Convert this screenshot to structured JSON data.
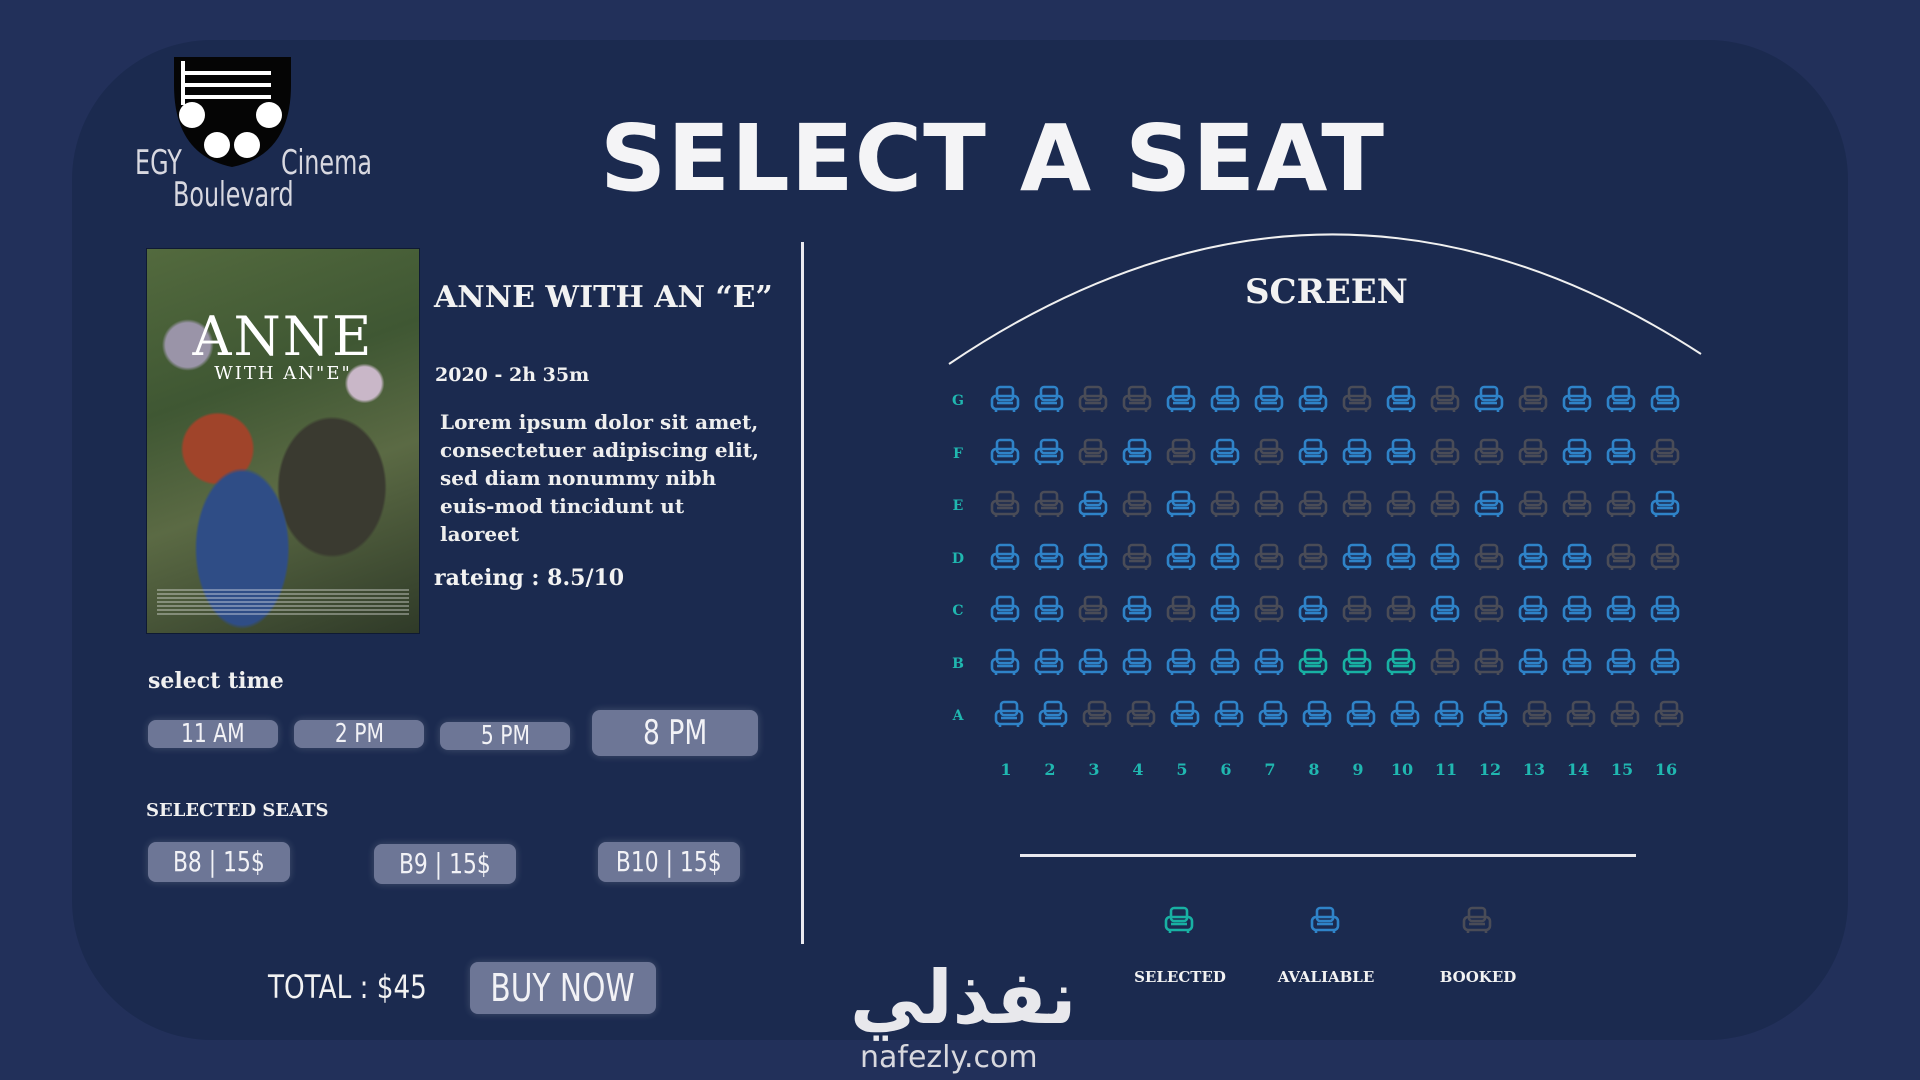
{
  "brand": {
    "line1_left": "EGY",
    "line1_right": "Cinema",
    "line2": "Boulevard"
  },
  "page_title": "SELECT A SEAT",
  "movie": {
    "poster_title": "ANNE",
    "poster_subtitle": "WITH AN\"E\"",
    "title": "ANNE WITH AN “E”",
    "meta": "2020 - 2h 35m",
    "description": "Lorem ipsum dolor sit amet, consectetuer adipiscing elit, sed diam nonummy nibh euis-mod tincidunt ut laoreet",
    "rating": "rateing : 8.5/10"
  },
  "time_select": {
    "label": "select time",
    "options": [
      "11 AM",
      "2 PM",
      "5 PM",
      "8 PM"
    ],
    "selected": "8 PM"
  },
  "selected_seats": {
    "label": "SELECTED SEATS",
    "items": [
      "B8 | 15$",
      "B9 | 15$",
      "B10 | 15$"
    ]
  },
  "total": "TOTAL : $45",
  "buy_button": "BUY NOW",
  "screen_label": "SCREEN",
  "seat_map": {
    "rows": [
      "G",
      "F",
      "E",
      "D",
      "C",
      "B",
      "A"
    ],
    "columns": [
      "1",
      "2",
      "3",
      "4",
      "5",
      "6",
      "7",
      "8",
      "9",
      "10",
      "11",
      "12",
      "13",
      "14",
      "15",
      "16"
    ],
    "status_codes": {
      "a": "available",
      "s": "selected",
      "b": "booked"
    },
    "layout": {
      "G": "aabbaaaabababaaa",
      "F": "aabababaaabbbaab",
      "E": "bbababbbbbbabbba",
      "D": "aaabaabbaaabaabb",
      "C": "aababababbabaaaa",
      "B": "aaaaaaasssbbaaaa",
      "A": "aabbaaaaaaaabbbb"
    }
  },
  "legend": [
    {
      "status": "selected",
      "label": "SELECTED"
    },
    {
      "status": "available",
      "label": "AVALIABLE"
    },
    {
      "status": "booked",
      "label": "BOOKED"
    }
  ],
  "colors": {
    "available": "#2f83c8",
    "selected": "#18b1a3",
    "booked": "#4a4c57",
    "panel": "#1b2a4f",
    "pill": "#6d7696"
  },
  "watermark": {
    "arabic": "نفذلي",
    "latin": "nafezly.com"
  }
}
